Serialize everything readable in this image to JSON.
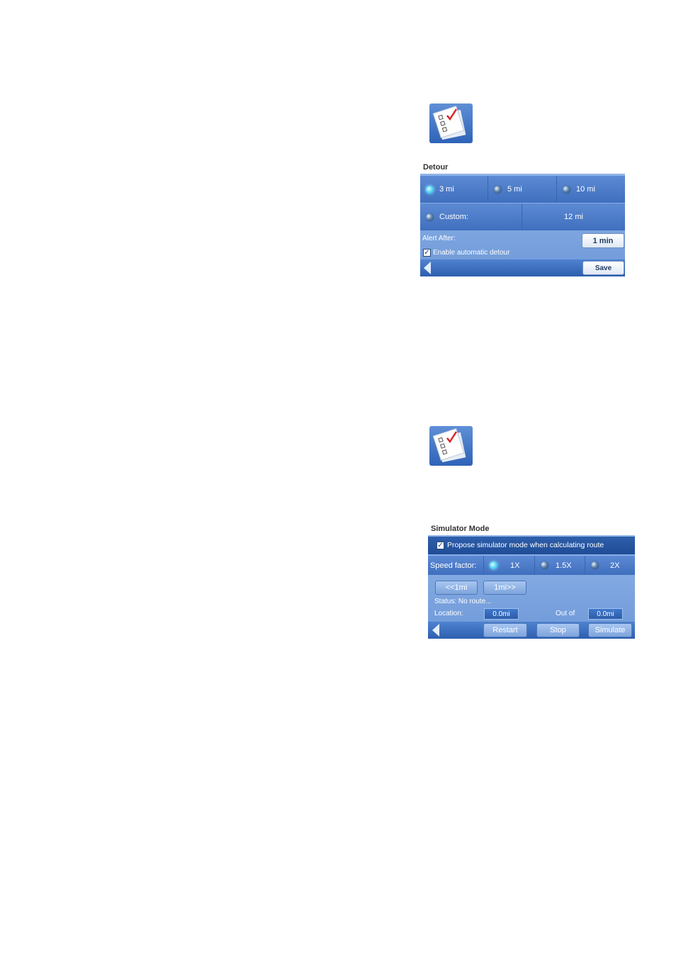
{
  "icons": {
    "top": "checklist-icon",
    "bottom": "checklist-icon"
  },
  "detour": {
    "title": "Detour",
    "options": [
      "3 mi",
      "5 mi",
      "10 mi"
    ],
    "selected": "3 mi",
    "custom_label": "Custom:",
    "custom_value": "12 mi",
    "alert_label": "Alert After:",
    "alert_value": "1 min",
    "enable_label": "Enable automatic detour",
    "enable_checked": true,
    "save_label": "Save"
  },
  "simulator": {
    "title": "Simulator Mode",
    "propose_label": "Propose simulator mode when calculating route",
    "propose_checked": true,
    "speed_label": "Speed factor:",
    "speed_options": [
      "1X",
      "1.5X",
      "2X"
    ],
    "speed_selected": "1X",
    "back_label": "<<1mi",
    "forward_label": "1mi>>",
    "status": "Status: No route...",
    "location_label": "Location:",
    "location_value": "0.0mi",
    "outof_label": "Out of",
    "outof_value": "0.0mi",
    "restart_label": "Restart",
    "stop_label": "Stop",
    "simulate_label": "Simulate"
  },
  "colors": {
    "panel": "#6e98d8",
    "selected_radio": "#56d8f6"
  }
}
